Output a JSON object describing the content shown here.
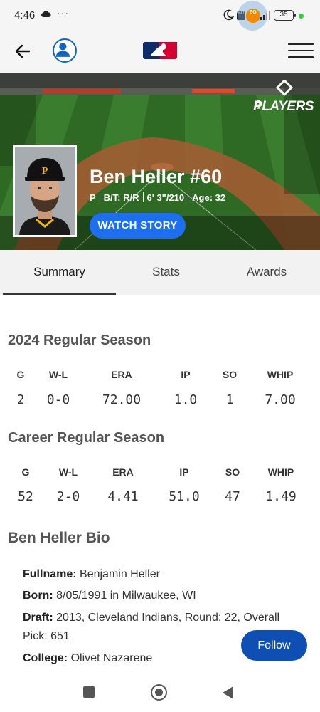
{
  "status_bar": {
    "time": "4:46",
    "dots": "···",
    "network_badge": "5G",
    "lte_badge": "VoLTE",
    "battery": "35",
    "dot_color": "#2ecc40"
  },
  "header": {
    "back_icon": "arrow-left-icon",
    "profile_icon": "user-profile-icon",
    "logo_icon": "mlb-logo-icon",
    "menu_icon": "hamburger-menu-icon"
  },
  "hero": {
    "brand_word": "PLAYERS",
    "brand_small": "MLB",
    "player_name": "Ben Heller #60",
    "meta": {
      "position": "P",
      "bats_throws": "B/T: R/R",
      "height_weight": "6' 3\"/210",
      "age": "Age: 32"
    },
    "watch_story_label": "WATCH STORY",
    "accent_color": "#1e6ef0"
  },
  "tabs": [
    {
      "label": "Summary",
      "active": true
    },
    {
      "label": "Stats",
      "active": false
    },
    {
      "label": "Awards",
      "active": false
    }
  ],
  "season_stats": {
    "title": "2024 Regular Season",
    "headers": [
      "G",
      "W-L",
      "ERA",
      "IP",
      "SO",
      "WHIP"
    ],
    "values": [
      "2",
      "0-0",
      "72.00",
      "1.0",
      "1",
      "7.00"
    ]
  },
  "career_stats": {
    "title": "Career Regular Season",
    "headers": [
      "G",
      "W-L",
      "ERA",
      "IP",
      "SO",
      "WHIP"
    ],
    "values": [
      "52",
      "2-0",
      "4.41",
      "51.0",
      "47",
      "1.49"
    ]
  },
  "bio": {
    "title": "Ben Heller Bio",
    "fullname_label": "Fullname:",
    "fullname": "Benjamin Heller",
    "born_label": "Born:",
    "born": "8/05/1991 in Milwaukee, WI",
    "draft_label": "Draft:",
    "draft_line1": "2013, Cleveland Indians, Round: 22, Overall",
    "draft_line2": "Pick: 651",
    "college_label": "College:",
    "college": "Olivet Nazarene"
  },
  "follow_label": "Follow",
  "nav": {
    "recents_icon": "square-recents-icon",
    "home_icon": "circle-home-icon",
    "back_icon": "triangle-back-icon"
  }
}
